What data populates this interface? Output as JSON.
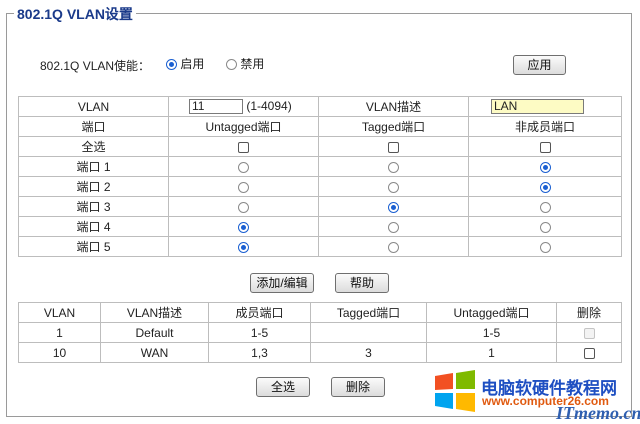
{
  "title": "802.1Q VLAN设置",
  "enable": {
    "label": "802.1Q VLAN使能：",
    "on_label": "启用",
    "off_label": "禁用",
    "selected": "on"
  },
  "apply_label": "应用",
  "config": {
    "vlan_label": "VLAN",
    "vlan_id": "11",
    "vlan_range": "(1-4094)",
    "desc_label": "VLAN描述",
    "desc_value": "LAN",
    "headers": [
      "端口",
      "Untagged端口",
      "Tagged端口",
      "非成员端口"
    ],
    "select_all": "全选",
    "ports": [
      {
        "name": "端口 1",
        "mode": "non"
      },
      {
        "name": "端口 2",
        "mode": "non"
      },
      {
        "name": "端口 3",
        "mode": "tagged"
      },
      {
        "name": "端口 4",
        "mode": "untagged"
      },
      {
        "name": "端口 5",
        "mode": "untagged"
      }
    ]
  },
  "add_edit_label": "添加/编辑",
  "help_label": "帮助",
  "list": {
    "headers": [
      "VLAN",
      "VLAN描述",
      "成员端口",
      "Tagged端口",
      "Untagged端口",
      "删除"
    ],
    "rows": [
      {
        "vlan": "1",
        "desc": "Default",
        "members": "1-5",
        "tagged": "",
        "untagged": "1-5",
        "deletable": false
      },
      {
        "vlan": "10",
        "desc": "WAN",
        "members": "1,3",
        "tagged": "3",
        "untagged": "1",
        "deletable": true
      }
    ]
  },
  "select_all_label": "全选",
  "delete_label": "删除",
  "watermark": {
    "line1": "电脑软硬件教程网",
    "line2": "www.computer26.com",
    "line3": "ITmemo.cn"
  },
  "colors": {
    "accent": "#1a5fd1",
    "title": "#1a3a8a",
    "desc_bg": "#fdfbc4"
  }
}
